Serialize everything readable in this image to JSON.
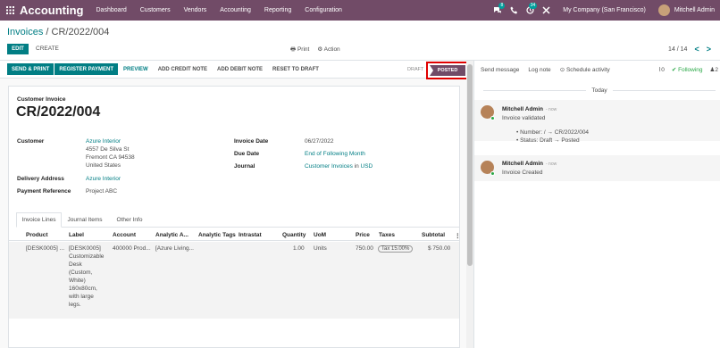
{
  "topbar": {
    "app_name": "Accounting",
    "menu": [
      "Dashboard",
      "Customers",
      "Vendors",
      "Accounting",
      "Reporting",
      "Configuration"
    ],
    "messages_badge": "8",
    "activities_badge": "34",
    "company": "My Company (San Francisco)",
    "user": "Mitchell Admin"
  },
  "control_panel": {
    "breadcrumb_parent": "Invoices",
    "breadcrumb_sep": " / ",
    "breadcrumb_current": "CR/2022/004",
    "edit_label": "EDIT",
    "create_label": "CREATE",
    "print_label": "Print",
    "action_label": "Action",
    "pager_value": "14 / 14",
    "prev_glyph": "<",
    "next_glyph": ">"
  },
  "statusbar": {
    "send_print": "SEND & PRINT",
    "register_payment": "REGISTER PAYMENT",
    "preview": "PREVIEW",
    "add_credit_note": "ADD CREDIT NOTE",
    "add_debit_note": "ADD DEBIT NOTE",
    "reset_to_draft": "RESET TO DRAFT",
    "state_draft": "DRAFT",
    "state_posted": "POSTED"
  },
  "invoice": {
    "kind": "Customer Invoice",
    "name": "CR/2022/004",
    "customer_label": "Customer",
    "customer_name": "Azure Interior",
    "address_line1": "4557 De Silva St",
    "address_line2": "Fremont CA 94538",
    "address_line3": "United States",
    "delivery_label": "Delivery Address",
    "delivery_value": "Azure Interior",
    "payment_ref_label": "Payment Reference",
    "payment_ref_value": "Project ABC",
    "invoice_date_label": "Invoice Date",
    "invoice_date_value": "06/27/2022",
    "due_date_label": "Due Date",
    "due_date_value": "End of Following Month",
    "journal_label": "Journal",
    "journal_value": "Customer Invoices",
    "journal_in": "in",
    "currency": "USD"
  },
  "tabs": [
    "Invoice Lines",
    "Journal Items",
    "Other Info"
  ],
  "lines": {
    "headers": [
      "Product",
      "Label",
      "Account",
      "Analytic A...",
      "Analytic Tags",
      "Intrastat",
      "Quantity",
      "UoM",
      "Price",
      "Taxes",
      "Subtotal"
    ],
    "row": {
      "product": "[DESK0005] ...",
      "label": [
        "[DESK0005]",
        "Customizable",
        "Desk",
        "(Custom,",
        "White)",
        "160x80cm,",
        "with large",
        "legs."
      ],
      "account": "400000 Prod...",
      "analytic": "[Azure Living...",
      "quantity": "1.00",
      "uom": "Units",
      "price": "750.00",
      "tax": "Tax 15.00%",
      "subtotal": "$ 750.00"
    }
  },
  "chatter": {
    "send_message": "Send message",
    "log_note": "Log note",
    "schedule_activity": "Schedule activity",
    "attachments_count": "0",
    "following": "Following",
    "followers_count": "2",
    "today": "Today",
    "messages": [
      {
        "author": "Mitchell Admin",
        "date": "- now",
        "body": "Invoice validated",
        "tracking": [
          "Number: / → CR/2022/004",
          "Status: Draft → Posted"
        ]
      },
      {
        "author": "Mitchell Admin",
        "date": "- now",
        "body": "Invoice Created"
      }
    ]
  },
  "colors": {
    "brand": "#714b67",
    "primary": "#017e84",
    "highlight_box": "#e00000"
  }
}
